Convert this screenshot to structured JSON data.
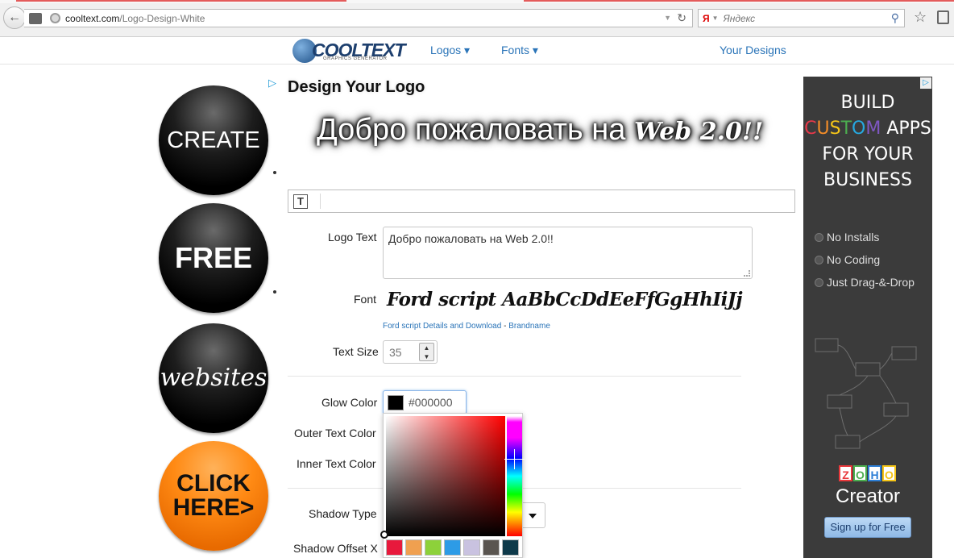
{
  "browser": {
    "url_domain": "cooltext.com",
    "url_path": "/Logo-Design-White",
    "search_placeholder": "Яндекс",
    "search_engine_badge": "Я"
  },
  "nav": {
    "logo_text": "COOLTEXT",
    "logo_sub": "GRAPHICS GENERATOR",
    "logos": "Logos ▾",
    "fonts": "Fonts ▾",
    "your_designs": "Your Designs"
  },
  "left_ads": {
    "create": "CREATE",
    "free": "FREE",
    "websites": "websites",
    "click_here_1": "CLICK",
    "click_here_2": "HERE>"
  },
  "main": {
    "title": "Design Your Logo",
    "preview_text": "Добро пожаловать на ",
    "preview_script": "Web 2.0!!",
    "logo_text_label": "Logo Text",
    "logo_text_value": "Добро пожаловать на Web 2.0!!",
    "font_label": "Font",
    "font_sample": "Ford script AaBbCcDdEeFfGgHhIiJj",
    "font_details_link": "Ford script Details and Download",
    "font_link_sep": " - ",
    "font_brand_link": "Brandname",
    "text_size_label": "Text Size",
    "text_size_value": "35",
    "glow_color_label": "Glow Color",
    "glow_color_value": "#000000",
    "outer_text_color_label": "Outer Text Color",
    "inner_text_color_label": "Inner Text Color",
    "shadow_type_label": "Shadow Type",
    "shadow_offset_x_label": "Shadow Offset X"
  },
  "picker": {
    "swatches": [
      "#e8193c",
      "#f0a050",
      "#8dd13a",
      "#2d9be6",
      "#c9c2e0",
      "#5a5550",
      "#0f3a4a"
    ]
  },
  "right_ad": {
    "line1": "BUILD",
    "custom_letters": [
      "C",
      "U",
      "S",
      "T",
      "O",
      "M"
    ],
    "apps": " APPS",
    "line3": "FOR YOUR",
    "line4": "BUSINESS",
    "features": [
      "No Installs",
      "No Coding",
      "Just Drag-&-Drop"
    ],
    "zoho_letters": [
      "Z",
      "O",
      "H",
      "O"
    ],
    "creator": "Creator",
    "signup": "Sign up for Free"
  }
}
